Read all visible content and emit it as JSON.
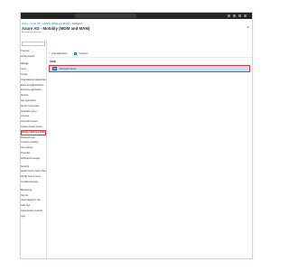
{
  "breadcrumb": [
    "Home",
    "Azure AD",
    "Mobility (MDM and MAM)",
    "Configure"
  ],
  "page": {
    "title": "Azure AD - Mobility (MDM and MAM)",
    "subtitle": "Azure Active Directory"
  },
  "sidebar": {
    "items": [
      {
        "label": "Overview",
        "section": false
      },
      {
        "label": "Getting started",
        "section": false
      },
      {
        "label": "Manage",
        "section": true
      },
      {
        "label": "Users",
        "section": false
      },
      {
        "label": "Groups",
        "section": false
      },
      {
        "label": "Organizational relationships",
        "section": false
      },
      {
        "label": "Roles and administrators",
        "section": false
      },
      {
        "label": "Enterprise applications",
        "section": false
      },
      {
        "label": "Devices",
        "section": false
      },
      {
        "label": "App registrations",
        "section": false
      },
      {
        "label": "Identity Governance",
        "section": false
      },
      {
        "label": "Application proxy",
        "section": false
      },
      {
        "label": "Licenses",
        "section": false
      },
      {
        "label": "Azure AD Connect",
        "section": false
      },
      {
        "label": "Custom domain names",
        "section": false
      },
      {
        "label": "Mobility (MDM and MAM)",
        "section": false,
        "selected": true
      },
      {
        "label": "Password reset",
        "section": false
      },
      {
        "label": "Company branding",
        "section": false
      },
      {
        "label": "User settings",
        "section": false
      },
      {
        "label": "Properties",
        "section": false
      },
      {
        "label": "Notifications settings",
        "section": false
      },
      {
        "label": "Security",
        "section": true
      },
      {
        "label": "Identity Secure Score (Preview)",
        "section": false
      },
      {
        "label": "Identity Secure Score",
        "section": false
      },
      {
        "label": "Conditional Access",
        "section": false
      },
      {
        "label": "Monitoring",
        "section": true
      },
      {
        "label": "Sign-ins",
        "section": false
      },
      {
        "label": "Users flagged for risk",
        "section": false
      },
      {
        "label": "Audit logs",
        "section": false
      },
      {
        "label": "Authentication methods",
        "section": false
      },
      {
        "label": "Logs",
        "section": false
      }
    ]
  },
  "toolbar": {
    "add_label": "Add application",
    "columns_label": "Columns"
  },
  "table": {
    "column_name": "NAME",
    "rows": [
      {
        "name": "Microsoft Intune"
      }
    ]
  }
}
